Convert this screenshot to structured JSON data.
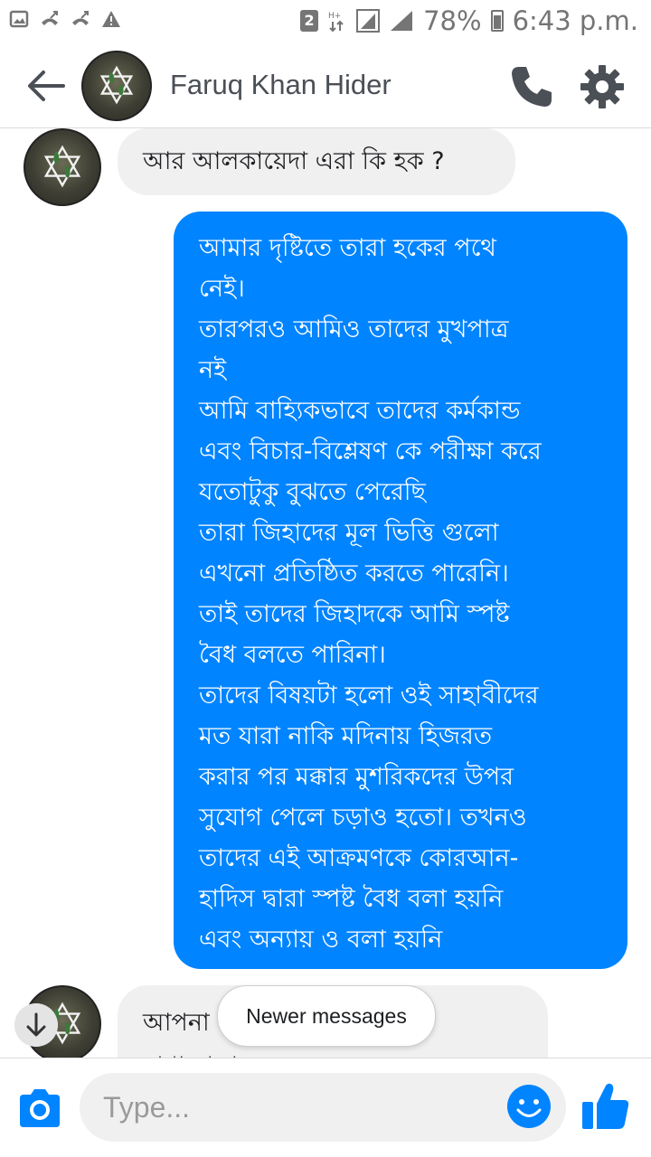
{
  "status_bar": {
    "battery": "78%",
    "time": "6:43 p.m.",
    "sim_slot": "2"
  },
  "header": {
    "contact_name": "Faruq Khan Hider"
  },
  "messages": [
    {
      "direction": "incoming",
      "text": "আর আলকায়েদা এরা কি হক ?"
    },
    {
      "direction": "outgoing",
      "lines": [
        "আমার দৃষ্টিতে তারা হকের পথে",
        "নেই।",
        "তারপরও আমিও তাদের মুখপাত্র",
        "নই",
        "আমি বাহ্যিকভাবে তাদের কর্মকান্ড",
        "এবং বিচার-বিশ্লেষণ কে পরীক্ষা করে",
        "যতোটুকু বুঝতে পেরেছি",
        "তারা জিহাদের মূল ভিত্তি গুলো",
        "এখনো প্রতিষ্ঠিত করতে পারেনি।",
        "তাই তাদের জিহাদকে আমি স্পষ্ট",
        "বৈধ বলতে পারিনা।",
        "তাদের বিষয়টা হলো ওই সাহাবীদের",
        "মত যারা নাকি মদিনায় হিজরত",
        "করার পর মক্কার মুশরিকদের উপর",
        "সুযোগ পেলে চড়াও হতো। তখনও",
        "তাদের এই আক্রমণকে কোরআন-",
        "হাদিস দ্বারা স্পষ্ট বৈধ বলা হয়নি",
        "এবং অন্যায় ও বলা হয়নি"
      ]
    },
    {
      "direction": "incoming",
      "text": "আপনা",
      "text2": "মাশাআল্লাহ"
    }
  ],
  "newer_messages_label": "Newer messages",
  "composer": {
    "placeholder": "Type..."
  },
  "colors": {
    "accent": "#0084ff",
    "incoming_bubble": "#f1f0f0",
    "icon_dark": "#4b4f56"
  },
  "icons": [
    "gallery-icon",
    "missed-call-icon",
    "warning-icon",
    "back-arrow-icon",
    "phone-icon",
    "gear-icon",
    "camera-icon",
    "emoji-icon",
    "thumbs-up-icon",
    "arrow-down-icon"
  ]
}
